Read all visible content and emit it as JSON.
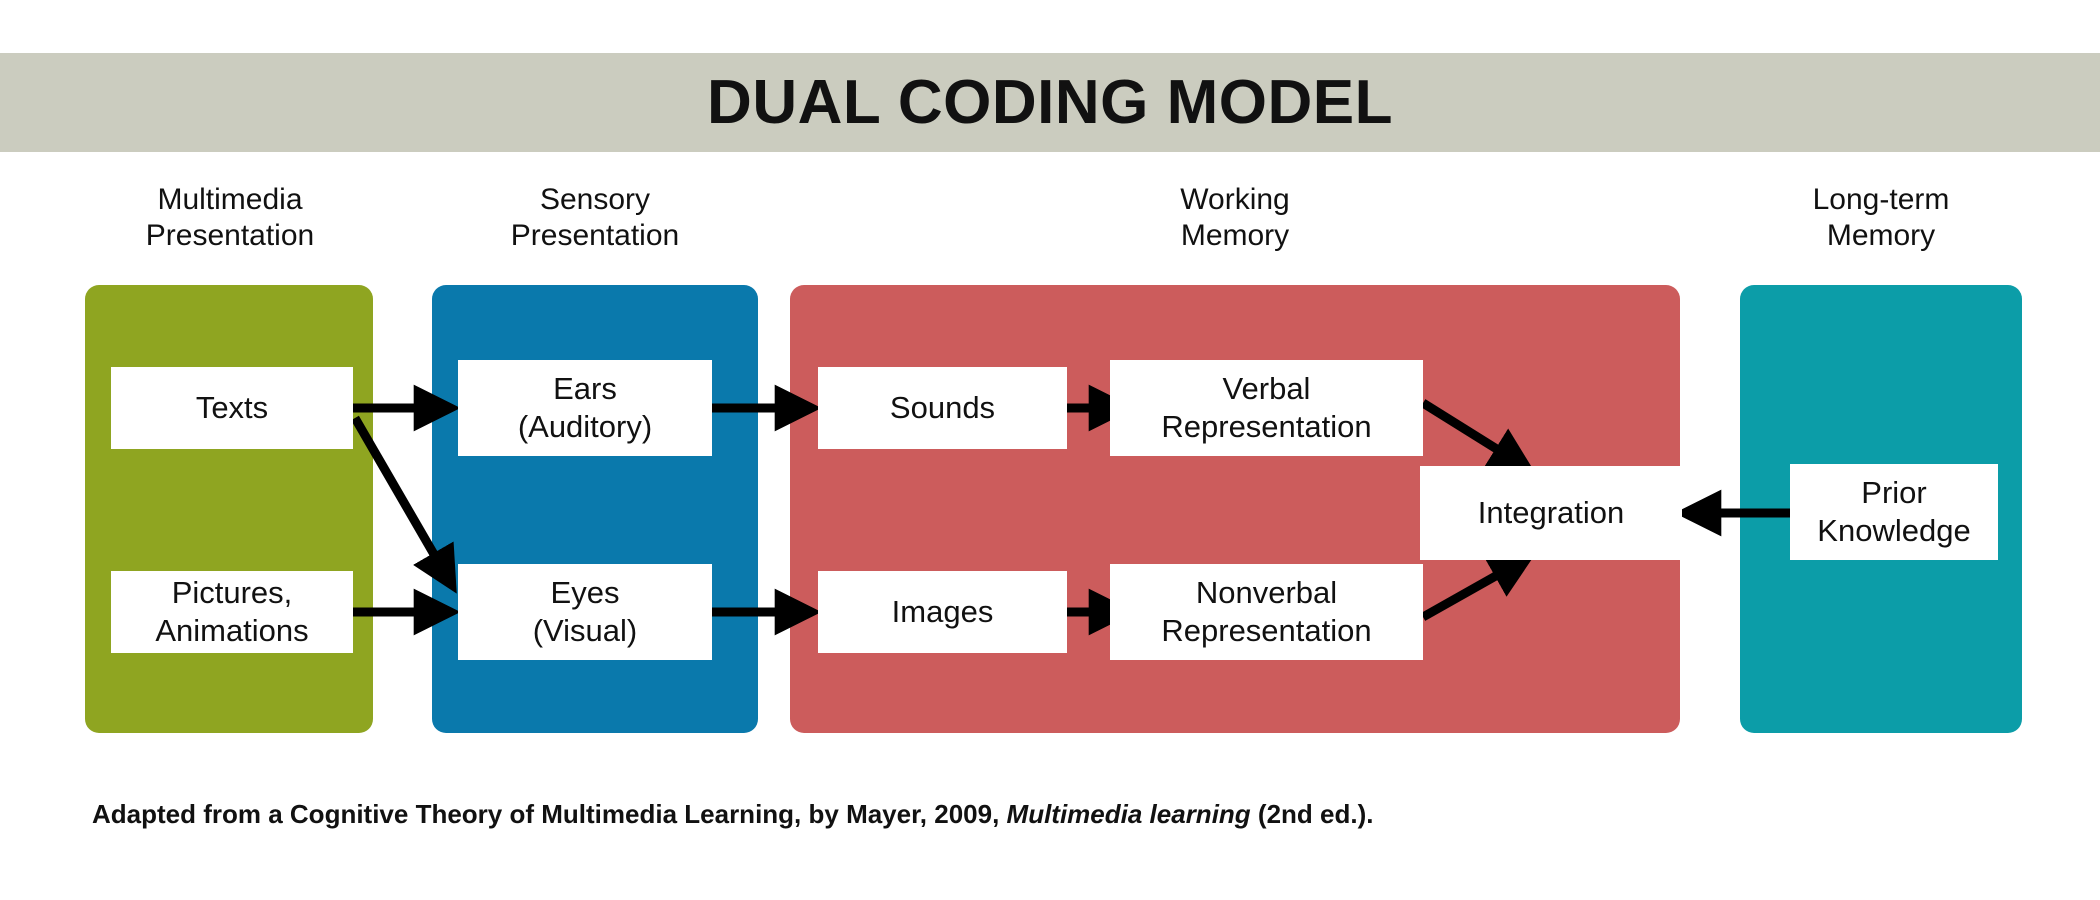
{
  "title": "DUAL CODING MODEL",
  "colors": {
    "banner": "#CBCCBF",
    "multimedia_panel": "#8FA521",
    "sensory_panel": "#0A79AC",
    "working_panel": "#CC5C5C",
    "longterm_panel": "#0C9DA8",
    "node_fill": "#FFFFFF",
    "arrow": "#000000",
    "text": "#111111",
    "background": "#FFFFFF"
  },
  "columns": [
    {
      "id": "multimedia",
      "label": "Multimedia\nPresentation"
    },
    {
      "id": "sensory",
      "label": "Sensory\nPresentation"
    },
    {
      "id": "working",
      "label": "Working\nMemory"
    },
    {
      "id": "longterm",
      "label": "Long-term\nMemory"
    }
  ],
  "nodes": {
    "texts": "Texts",
    "pictures": "Pictures,\nAnimations",
    "ears": "Ears\n(Auditory)",
    "eyes": "Eyes\n(Visual)",
    "sounds": "Sounds",
    "images": "Images",
    "verbal": "Verbal\nRepresentation",
    "nonverbal": "Nonverbal\nRepresentation",
    "integration": "Integration",
    "prior_knowledge": "Prior\nKnowledge"
  },
  "caption": {
    "lead": "Adapted from a Cognitive Theory of Multimedia Learning, by Mayer, 2009, ",
    "italic": "Multimedia learning",
    "tail": " (2nd ed.)."
  },
  "chart_data": {
    "type": "diagram",
    "title": "DUAL CODING MODEL",
    "stages": [
      {
        "name": "Multimedia Presentation",
        "color": "#8FA521",
        "nodes": [
          "Texts",
          "Pictures, Animations"
        ]
      },
      {
        "name": "Sensory Presentation",
        "color": "#0A79AC",
        "nodes": [
          "Ears (Auditory)",
          "Eyes (Visual)"
        ]
      },
      {
        "name": "Working Memory",
        "color": "#CC5C5C",
        "nodes": [
          "Sounds",
          "Images",
          "Verbal Representation",
          "Nonverbal Representation",
          "Integration"
        ]
      },
      {
        "name": "Long-term Memory",
        "color": "#0C9DA8",
        "nodes": [
          "Prior Knowledge"
        ]
      }
    ],
    "edges": [
      {
        "from": "Texts",
        "to": "Ears (Auditory)",
        "style": "straight"
      },
      {
        "from": "Texts",
        "to": "Eyes (Visual)",
        "style": "diagonal"
      },
      {
        "from": "Pictures, Animations",
        "to": "Eyes (Visual)",
        "style": "straight"
      },
      {
        "from": "Ears (Auditory)",
        "to": "Sounds",
        "style": "straight"
      },
      {
        "from": "Eyes (Visual)",
        "to": "Images",
        "style": "straight"
      },
      {
        "from": "Sounds",
        "to": "Verbal Representation",
        "style": "straight"
      },
      {
        "from": "Images",
        "to": "Nonverbal Representation",
        "style": "straight"
      },
      {
        "from": "Verbal Representation",
        "to": "Integration",
        "style": "diagonal"
      },
      {
        "from": "Nonverbal Representation",
        "to": "Integration",
        "style": "diagonal"
      },
      {
        "from": "Prior Knowledge",
        "to": "Integration",
        "style": "straight"
      }
    ]
  }
}
